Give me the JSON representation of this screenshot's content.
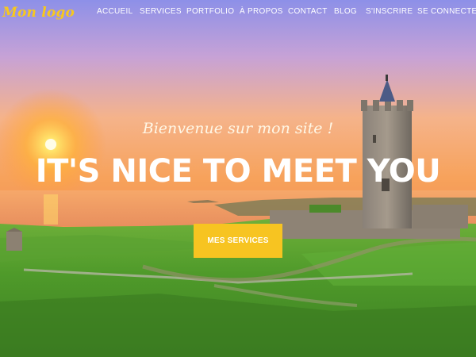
{
  "brand": {
    "logo_text": "Mon logo",
    "accent_color": "#f7c421"
  },
  "nav": {
    "items": [
      {
        "label": "ACCUEIL"
      },
      {
        "label": "SERVICES"
      },
      {
        "label": "PORTFOLIO"
      },
      {
        "label": "À PROPOS"
      },
      {
        "label": "CONTACT"
      },
      {
        "label": "BLOG"
      },
      {
        "label": "S'INSCRIRE"
      },
      {
        "label": "SE CONNECTER"
      }
    ]
  },
  "hero": {
    "subtitle": "Bienvenue sur mon site !",
    "title": "IT'S NICE TO MEET YOU",
    "cta_label": "MES SERVICES",
    "background": "sunset-castle-landscape"
  }
}
